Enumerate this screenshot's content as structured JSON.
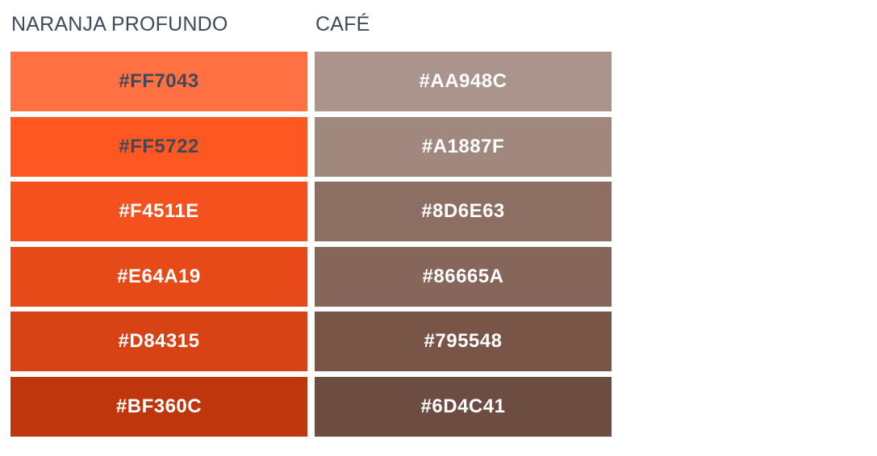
{
  "palettes": [
    {
      "title": "NARANJA PROFUNDO",
      "swatches": [
        {
          "hex": "#FF7043",
          "color": "#FF7043",
          "text_color": "#3E4A59"
        },
        {
          "hex": "#FF5722",
          "color": "#FF5722",
          "text_color": "#3E4A59"
        },
        {
          "hex": "#F4511E",
          "color": "#F4511E",
          "text_color": "#FFFFFF"
        },
        {
          "hex": "#E64A19",
          "color": "#E64A19",
          "text_color": "#FFFFFF"
        },
        {
          "hex": "#D84315",
          "color": "#D84315",
          "text_color": "#FFFFFF"
        },
        {
          "hex": "#BF360C",
          "color": "#BF360C",
          "text_color": "#FFFFFF"
        }
      ]
    },
    {
      "title": "CAFÉ",
      "swatches": [
        {
          "hex": "#AA948C",
          "color": "#AA948C",
          "text_color": "#FFFFFF"
        },
        {
          "hex": "#A1887F",
          "color": "#A1887F",
          "text_color": "#FFFFFF"
        },
        {
          "hex": "#8D6E63",
          "color": "#8D6E63",
          "text_color": "#FFFFFF"
        },
        {
          "hex": "#86665A",
          "color": "#86665A",
          "text_color": "#FFFFFF"
        },
        {
          "hex": "#795548",
          "color": "#795548",
          "text_color": "#FFFFFF"
        },
        {
          "hex": "#6D4C41",
          "color": "#6D4C41",
          "text_color": "#FFFFFF"
        }
      ]
    }
  ]
}
